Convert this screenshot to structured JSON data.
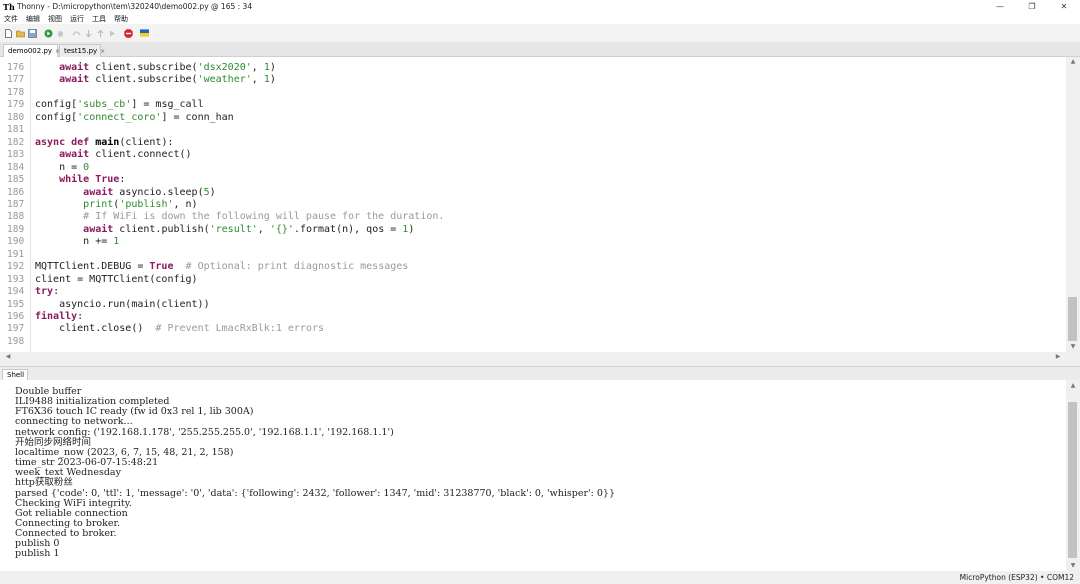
{
  "window": {
    "title": "Thonny  -  D:\\micropython\\tem\\320240\\demo002.py  @  165 : 34",
    "controls": [
      "—",
      "❐",
      "✕"
    ]
  },
  "menu": [
    "文件",
    "编辑",
    "视图",
    "运行",
    "工具",
    "帮助"
  ],
  "tabs": [
    {
      "label": "demo002.py",
      "close": "×"
    },
    {
      "label": "test15.py",
      "close": "×"
    }
  ],
  "editor": {
    "lines": [
      {
        "n": "176",
        "html": "    <span class=\"kw\">await</span> client.subscribe(<span class=\"str\">'dsx2020'</span>, <span class=\"num\">1</span>)"
      },
      {
        "n": "177",
        "html": "    <span class=\"kw\">await</span> client.subscribe(<span class=\"str\">'weather'</span>, <span class=\"num\">1</span>)"
      },
      {
        "n": "178",
        "html": ""
      },
      {
        "n": "179",
        "html": "config[<span class=\"str\">'subs_cb'</span>] = msg_call"
      },
      {
        "n": "180",
        "html": "config[<span class=\"str\">'connect_coro'</span>] = conn_han"
      },
      {
        "n": "181",
        "html": ""
      },
      {
        "n": "182",
        "html": "<span class=\"kw\">async def</span> <span class=\"fn\">main</span>(client):"
      },
      {
        "n": "183",
        "html": "    <span class=\"kw\">await</span> client.connect()"
      },
      {
        "n": "184",
        "html": "    n = <span class=\"num\">0</span>"
      },
      {
        "n": "185",
        "html": "    <span class=\"kw\">while</span> <span class=\"kw\">True</span>:"
      },
      {
        "n": "186",
        "html": "        <span class=\"kw\">await</span> asyncio.sleep(<span class=\"num\">5</span>)"
      },
      {
        "n": "187",
        "html": "        <span class=\"str\">print</span>(<span class=\"str\">'publish'</span>, n)"
      },
      {
        "n": "188",
        "html": "        <span class=\"cmt\"># If WiFi is down the following will pause for the duration.</span>"
      },
      {
        "n": "189",
        "html": "        <span class=\"kw\">await</span> client.publish(<span class=\"str\">'result'</span>, <span class=\"str\">'{}'</span>.format(n), qos = <span class=\"num\">1</span>)"
      },
      {
        "n": "190",
        "html": "        n += <span class=\"num\">1</span>"
      },
      {
        "n": "191",
        "html": ""
      },
      {
        "n": "192",
        "html": "MQTTClient.DEBUG = <span class=\"kw\">True</span>  <span class=\"cmt\"># Optional: print diagnostic messages</span>"
      },
      {
        "n": "193",
        "html": "client = MQTTClient(config)"
      },
      {
        "n": "194",
        "html": "<span class=\"kw\">try</span>:"
      },
      {
        "n": "195",
        "html": "    asyncio.run(main(client))"
      },
      {
        "n": "196",
        "html": "<span class=\"kw\">finally</span>:"
      },
      {
        "n": "197",
        "html": "    client.close()  <span class=\"cmt\"># Prevent LmacRxBlk:1 errors</span>"
      },
      {
        "n": "198",
        "html": ""
      }
    ]
  },
  "shell": {
    "tab_label": "Shell",
    "lines": [
      "Double buffer",
      "ILI9488 initialization completed",
      "FT6X36 touch IC ready (fw id 0x3 rel 1, lib 300A)",
      "connecting to network...",
      "network config: ('192.168.1.178', '255.255.255.0', '192.168.1.1', '192.168.1.1')",
      "开始同步网络时间",
      "localtime_now (2023, 6, 7, 15, 48, 21, 2, 158)",
      "time_str 2023-06-07-15:48:21",
      "week_text Wednesday",
      "http获取粉丝",
      "parsed {'code': 0, 'ttl': 1, 'message': '0', 'data': {'following': 2432, 'follower': 1347, 'mid': 31238770, 'black': 0, 'whisper': 0}}",
      "Checking WiFi integrity.",
      "Got reliable connection",
      "Connecting to broker.",
      "Connected to broker.",
      "publish 0",
      "publish 1"
    ]
  },
  "status": {
    "interpreter": "MicroPython (ESP32)  •  COM12"
  }
}
